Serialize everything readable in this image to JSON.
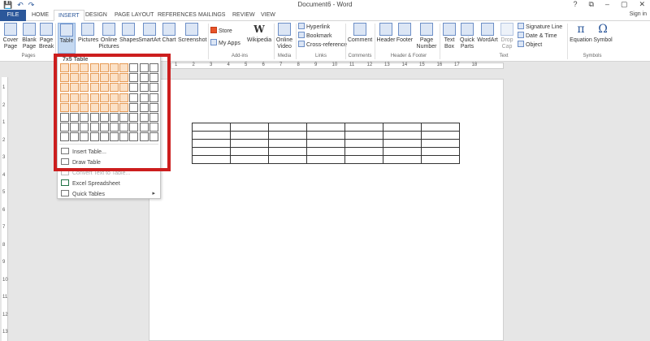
{
  "window": {
    "title": "Document6 - Word",
    "sign_in": "Sign in",
    "controls": [
      "?",
      "⧉",
      "–",
      "▢",
      "✕"
    ]
  },
  "quick_access": [
    "💾",
    "↶",
    "↷"
  ],
  "tabs": [
    "FILE",
    "HOME",
    "INSERT",
    "DESIGN",
    "PAGE LAYOUT",
    "REFERENCES",
    "MAILINGS",
    "REVIEW",
    "VIEW"
  ],
  "ribbon": {
    "pages": [
      "Cover Page",
      "Blank Page",
      "Page Break"
    ],
    "pages_group": "Pages",
    "table": "Table",
    "illustrations": [
      "Pictures",
      "Online Pictures",
      "Shapes",
      "SmartArt",
      "Chart",
      "Screenshot"
    ],
    "addins": {
      "store": "Store",
      "my_apps": "My Apps",
      "wikipedia": "Wikipedia",
      "group": "Add-ins"
    },
    "media": {
      "online_video": "Online Video",
      "group": "Media"
    },
    "links": {
      "hyperlink": "Hyperlink",
      "bookmark": "Bookmark",
      "cross_reference": "Cross-reference",
      "group": "Links"
    },
    "comments": {
      "comment": "Comment",
      "group": "Comments"
    },
    "header_footer": {
      "header": "Header",
      "footer": "Footer",
      "page_number": "Page Number",
      "group": "Header & Footer"
    },
    "text": {
      "text_box": "Text Box",
      "quick_parts": "Quick Parts",
      "wordart": "WordArt",
      "drop_cap": "Drop Cap",
      "signature_line": "Signature Line",
      "date_time": "Date & Time",
      "object": "Object",
      "group": "Text"
    },
    "symbols": {
      "equation": "Equation",
      "symbol": "Symbol",
      "group": "Symbols"
    }
  },
  "ruler_marks": [
    "1",
    "2",
    "3",
    "4",
    "5",
    "6",
    "7",
    "8",
    "9",
    "10",
    "11",
    "12",
    "13",
    "14",
    "15",
    "16",
    "17",
    "18"
  ],
  "vruler_marks": [
    "1",
    "2",
    "1",
    "2",
    "3",
    "4",
    "5",
    "6",
    "7",
    "8",
    "9",
    "10",
    "11",
    "12",
    "13"
  ],
  "table_menu": {
    "header": "7x5 Table",
    "grid_cols": 10,
    "grid_rows": 8,
    "selected_cols": 7,
    "selected_rows": 5,
    "items": [
      "Insert Table...",
      "Draw Table",
      "Convert Text to Table...",
      "Excel Spreadsheet",
      "Quick Tables"
    ]
  },
  "document_table": {
    "rows": 5,
    "cols": 7
  }
}
